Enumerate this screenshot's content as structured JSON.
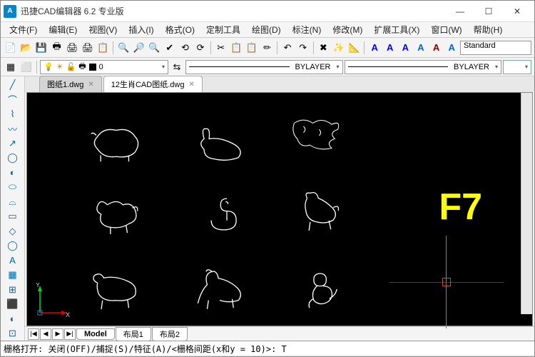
{
  "app": {
    "logo": "A",
    "title": "迅捷CAD编辑器 6.2 专业版"
  },
  "winbtns": {
    "min": "—",
    "max": "☐",
    "close": "✕"
  },
  "menu": [
    "文件(F)",
    "编辑(E)",
    "视图(V)",
    "插入(I)",
    "格式(O)",
    "定制工具",
    "绘图(D)",
    "标注(N)",
    "修改(M)",
    "扩展工具(X)",
    "窗口(W)",
    "帮助(H)"
  ],
  "toolbar1_icons": [
    "📄",
    "📂",
    "💾",
    "🖶",
    "🖨",
    "🖨",
    "📋",
    "|",
    "🔍",
    "🔎",
    "🔍",
    "✔",
    "⟲",
    "⟳",
    "|",
    "✂",
    "📋",
    "📋",
    "✏",
    "|",
    "↶",
    "↷",
    "|",
    "✖",
    "✨",
    "📐",
    "|"
  ],
  "text_icons": [
    "A",
    "A",
    "A",
    "A",
    "A",
    "A"
  ],
  "style_box": "Standard",
  "toolbar2_icons": [
    "▦",
    "⬜",
    "|",
    "💡",
    "🔒",
    "▾"
  ],
  "layer_combo": {
    "bulb": "💡",
    "sun": "☀",
    "lock": "🔓",
    "printer": "🖶",
    "color": "■",
    "name": "0",
    "dd": "▾"
  },
  "line_combos": [
    {
      "label": "BYLAYER",
      "dd": "▾"
    },
    {
      "label": "BYLAYER",
      "dd": "▾"
    }
  ],
  "angle_box": {
    "dd": "▾"
  },
  "left_tools": [
    "╱",
    "⌒",
    "⌇",
    "〰",
    "↗",
    "◯",
    "◐",
    "⬭",
    "⌓",
    "▭",
    "◇",
    "◯",
    "A",
    "▦",
    "⊞",
    "⬛",
    "◐",
    "⊡"
  ],
  "doc_tabs": [
    {
      "label": "图纸1.dwg",
      "active": false
    },
    {
      "label": "12生肖CAD图纸.dwg",
      "active": true
    }
  ],
  "canvas": {
    "overlay_key": "F7",
    "ucs": {
      "x": "X",
      "y": "Y"
    }
  },
  "layout": {
    "nav": [
      "|◀",
      "◀",
      "▶",
      "▶|"
    ],
    "tabs": [
      "Model",
      "布局1",
      "布局2"
    ]
  },
  "cmdline": "栅格打开:  关闭(OFF)/捕捉(S)/特征(A)/<栅格间距(x和y = 10)>:  T"
}
